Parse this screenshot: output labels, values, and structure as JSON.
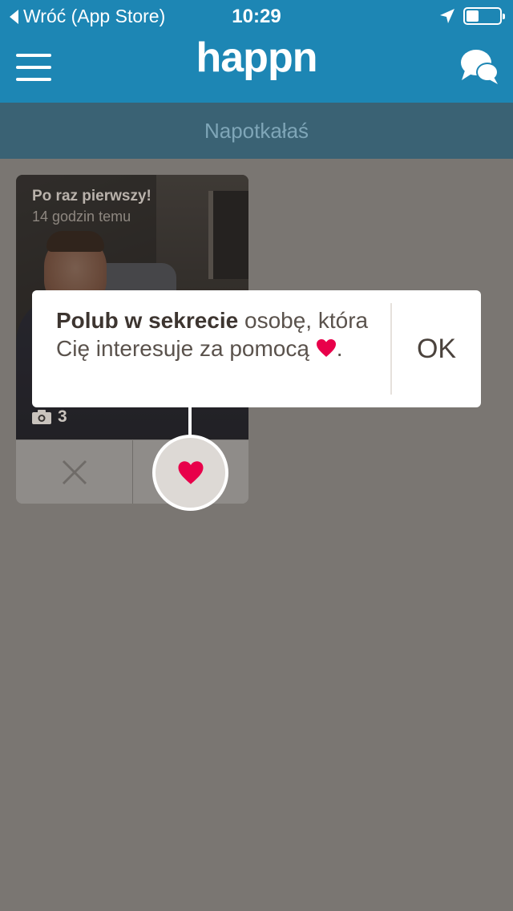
{
  "status_bar": {
    "back_label": "Wróć (App Store)",
    "time": "10:29"
  },
  "header": {
    "logo": "happn",
    "menu_icon": "hamburger-icon",
    "chat_icon": "chat-bubbles-icon"
  },
  "subheader": {
    "title": "Napotkałaś"
  },
  "card": {
    "headline": "Po raz pierwszy!",
    "time_ago": "14 godzin temu",
    "photo_count": "3"
  },
  "tooltip": {
    "bold_text": "Polub w sekrecie",
    "rest_text": " osobę, która Cię interesuje za pomocą ",
    "end_text": ".",
    "ok_label": "OK"
  },
  "colors": {
    "brand": "#1d86b4",
    "subheader": "#3a6274",
    "heart": "#e8004a",
    "overlay": "#7a7672"
  }
}
